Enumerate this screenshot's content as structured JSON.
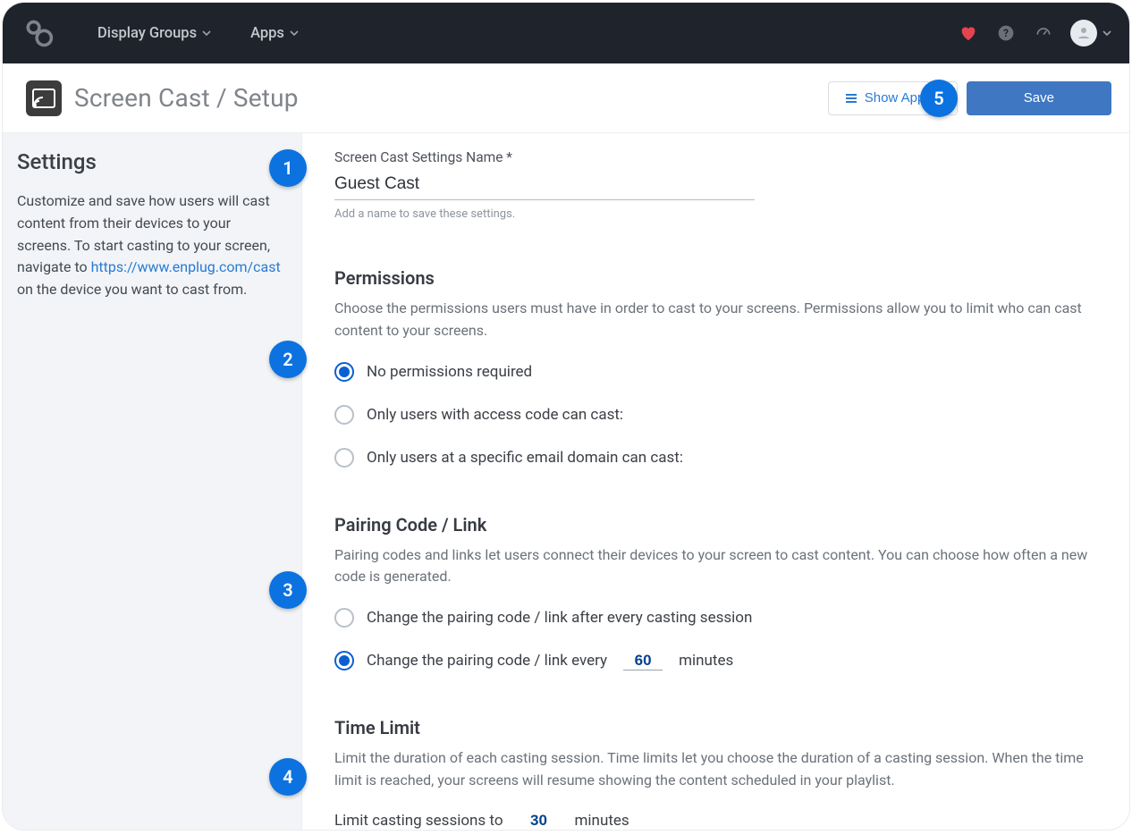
{
  "nav": {
    "display_groups": "Display Groups",
    "apps": "Apps"
  },
  "toolbar": {
    "title": "Screen Cast / Setup",
    "show_apps": "Show Apps",
    "save": "Save"
  },
  "sidebar": {
    "heading": "Settings",
    "text_pre": "Customize and save how users will cast content from their devices to your screens. To start casting to your screen, navigate to ",
    "link_text": "https://www.enplug.com/cast",
    "text_post": " on the device you want to cast from."
  },
  "form": {
    "name_label": "Screen Cast Settings Name *",
    "name_value": "Guest Cast",
    "name_hint": "Add a name to save these settings.",
    "permissions_title": "Permissions",
    "permissions_desc": "Choose the permissions users must have in order to cast to your screens. Permissions allow you to limit who can cast content to your screens.",
    "perm_option1": "No permissions required",
    "perm_option2": "Only users with access code can cast:",
    "perm_option3": "Only users at a specific email domain can cast:",
    "pairing_title": "Pairing Code / Link",
    "pairing_desc": "Pairing codes and links let users connect their devices to your screen to cast content. You can choose how often a new code is generated.",
    "pair_option1": "Change the pairing code / link after every casting session",
    "pair_option2_pre": "Change the pairing code / link every",
    "pair_minutes_value": "60",
    "pair_option2_post": "minutes",
    "time_title": "Time Limit",
    "time_desc": "Limit the duration of each casting session. Time limits let you choose the duration of a casting session. When the time limit is reached, your screens will resume showing the content scheduled in your playlist.",
    "time_limit_pre": "Limit casting sessions to",
    "time_limit_value": "30",
    "time_limit_post": "minutes"
  },
  "badges": {
    "b1": "1",
    "b2": "2",
    "b3": "3",
    "b4": "4",
    "b5": "5"
  }
}
